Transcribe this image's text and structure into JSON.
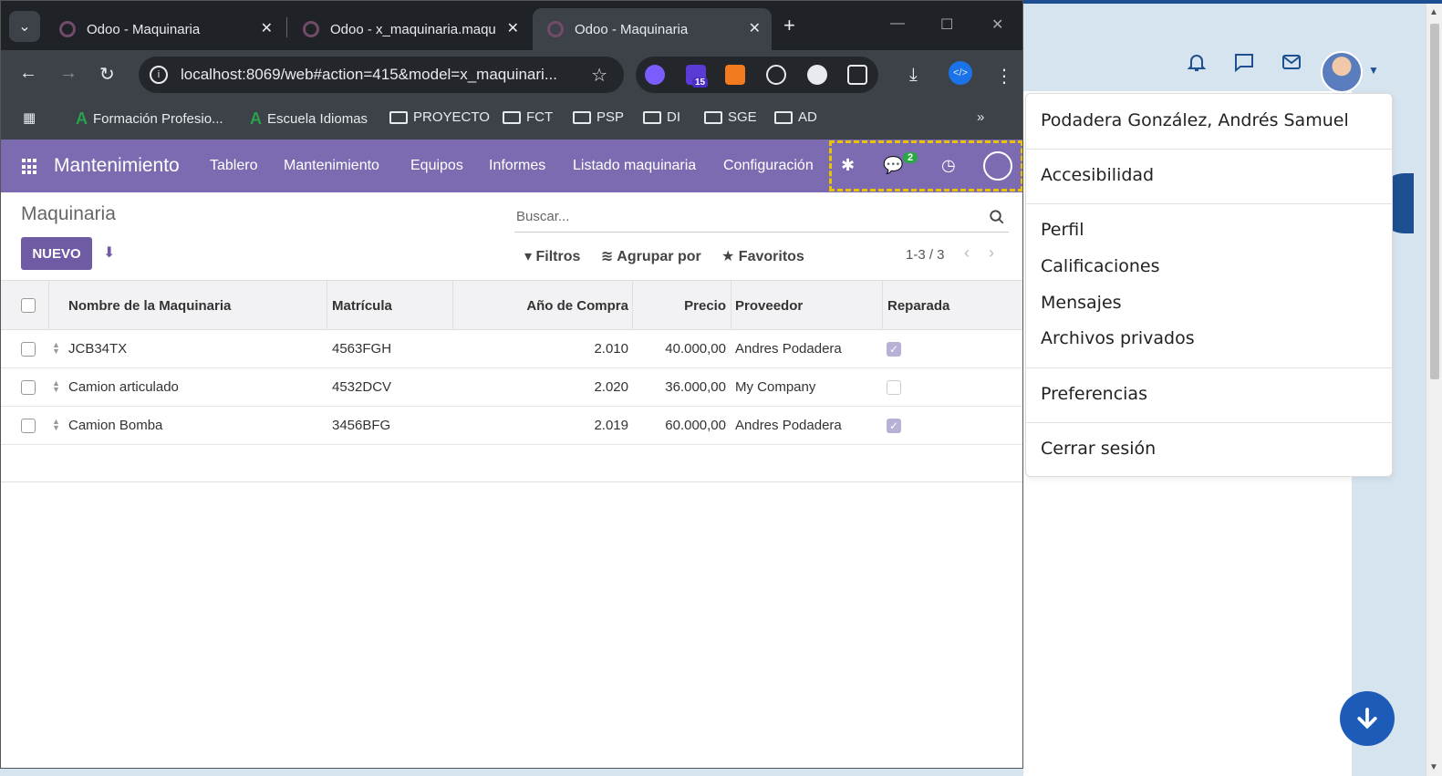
{
  "browser": {
    "tabs": [
      {
        "title": "Odoo - Maquinaria"
      },
      {
        "title": "Odoo - x_maquinaria.maqu"
      },
      {
        "title": "Odoo - Maquinaria"
      }
    ],
    "url": "localhost:8069/web#action=415&model=x_maquinari...",
    "extension_badge": "15",
    "bookmarks": [
      {
        "label": "Formación Profesio..."
      },
      {
        "label": "Escuela Idiomas"
      },
      {
        "label": "PROYECTO"
      },
      {
        "label": "FCT"
      },
      {
        "label": "PSP"
      },
      {
        "label": "DI"
      },
      {
        "label": "SGE"
      },
      {
        "label": "AD"
      }
    ]
  },
  "odoo": {
    "app_title": "Mantenimiento",
    "menu": [
      "Tablero",
      "Mantenimiento",
      "Equipos",
      "Informes",
      "Listado maquinaria",
      "Configuración"
    ],
    "messages_badge": "2",
    "breadcrumb": "Maquinaria",
    "new_button": "NUEVO",
    "search_placeholder": "Buscar...",
    "filters": "Filtros",
    "group_by": "Agrupar por",
    "favorites": "Favoritos",
    "pager": "1-3 / 3",
    "columns": [
      "Nombre de la Maquinaria",
      "Matrícula",
      "Año de Compra",
      "Precio",
      "Proveedor",
      "Reparada"
    ],
    "rows": [
      {
        "name": "JCB34TX",
        "plate": "4563FGH",
        "year": "2.010",
        "price": "40.000,00",
        "supplier": "Andres Podadera",
        "repaired": true
      },
      {
        "name": "Camion articulado",
        "plate": "4532DCV",
        "year": "2.020",
        "price": "36.000,00",
        "supplier": "My Company",
        "repaired": false
      },
      {
        "name": "Camion Bomba",
        "plate": "3456BFG",
        "year": "2.019",
        "price": "60.000,00",
        "supplier": "Andres Podadera",
        "repaired": true
      }
    ]
  },
  "dropdown": {
    "user_name": "Podadera González, Andrés Samuel",
    "accessibility": "Accesibilidad",
    "profile": "Perfil",
    "grades": "Calificaciones",
    "messages": "Mensajes",
    "private_files": "Archivos privados",
    "preferences": "Preferencias",
    "logout": "Cerrar sesión"
  },
  "colors": {
    "odoo_purple": "#7c6bb0",
    "brand_blue": "#1d4f91",
    "highlight_yellow": "#e9c200"
  }
}
